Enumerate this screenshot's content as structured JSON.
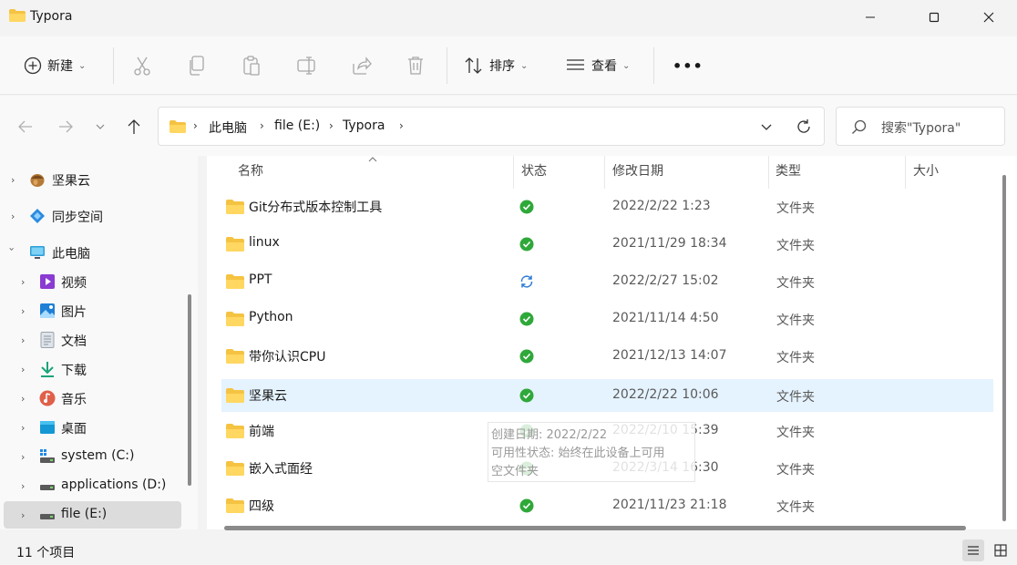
{
  "window": {
    "title": "Typora"
  },
  "toolbar": {
    "new_label": "新建",
    "sort_label": "排序",
    "view_label": "查看",
    "more_label": "•••"
  },
  "address": {
    "crumbs": [
      "此电脑",
      "file (E:)",
      "Typora"
    ],
    "search_placeholder": "搜索\"Typora\""
  },
  "sidebar": {
    "items": [
      {
        "label": "坚果云",
        "icon": "nut-icon"
      },
      {
        "label": "同步空间",
        "icon": "sync-space-icon"
      },
      {
        "label": "此电脑",
        "icon": "pc-icon"
      },
      {
        "label": "视频",
        "icon": "video-icon"
      },
      {
        "label": "图片",
        "icon": "pictures-icon"
      },
      {
        "label": "文档",
        "icon": "documents-icon"
      },
      {
        "label": "下载",
        "icon": "download-icon"
      },
      {
        "label": "音乐",
        "icon": "music-icon"
      },
      {
        "label": "桌面",
        "icon": "desktop-icon"
      },
      {
        "label": "system (C:)",
        "icon": "drive-icon"
      },
      {
        "label": "applications (D:)",
        "icon": "drive-icon"
      },
      {
        "label": "file (E:)",
        "icon": "drive-icon"
      }
    ]
  },
  "columns": {
    "name": "名称",
    "status": "状态",
    "date": "修改日期",
    "type": "类型",
    "size": "大小"
  },
  "files": [
    {
      "name": "Git分布式版本控制工具",
      "status": "synced",
      "date": "2022/2/22 1:23",
      "type": "文件夹"
    },
    {
      "name": "linux",
      "status": "synced",
      "date": "2021/11/29 18:34",
      "type": "文件夹"
    },
    {
      "name": "PPT",
      "status": "syncing",
      "date": "2022/2/27 15:02",
      "type": "文件夹"
    },
    {
      "name": "Python",
      "status": "synced",
      "date": "2021/11/14 4:50",
      "type": "文件夹"
    },
    {
      "name": "带你认识CPU",
      "status": "synced",
      "date": "2021/12/13 14:07",
      "type": "文件夹"
    },
    {
      "name": "坚果云",
      "status": "synced",
      "date": "2022/2/22 10:06",
      "type": "文件夹"
    },
    {
      "name": "前端",
      "status": "synced",
      "date": "2022/2/10 15:39",
      "type": "文件夹"
    },
    {
      "name": "嵌入式面经",
      "status": "synced",
      "date": "2022/3/14 16:30",
      "type": "文件夹"
    },
    {
      "name": "四级",
      "status": "synced",
      "date": "2021/11/23 21:18",
      "type": "文件夹"
    }
  ],
  "tooltip": {
    "line1": "创建日期: 2022/2/22",
    "line2": "可用性状态: 始终在此设备上可用",
    "line3": "空文件夹"
  },
  "statusbar": {
    "count": "11 个项目"
  },
  "colors": {
    "synced": "#2fa83a",
    "syncing": "#2b7ad6",
    "folder": "#f5c342",
    "selection": "#e5f3ff"
  }
}
